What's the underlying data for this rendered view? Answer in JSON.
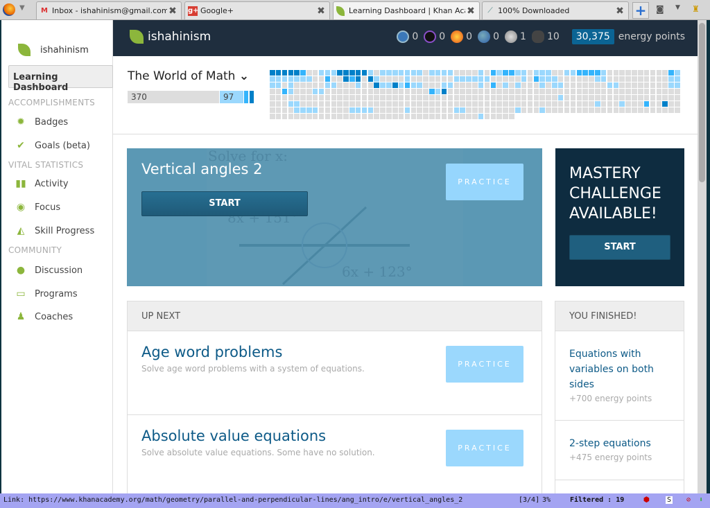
{
  "browser": {
    "tabs": [
      {
        "title": "Inbox - ishahinism@gmail.com ...",
        "icon": "gmail-icon"
      },
      {
        "title": "Google+",
        "icon": "google-plus-icon"
      },
      {
        "title": "Learning Dashboard | Khan Aca...",
        "icon": "khan-leaf-icon",
        "active": true
      },
      {
        "title": "100% Downloaded",
        "icon": "download-icon"
      }
    ],
    "new_tab": "+"
  },
  "header": {
    "site": "ishahinism",
    "badges": [
      {
        "icon": "challenge-patch-icon",
        "count": "0",
        "color": "#3b78b8"
      },
      {
        "icon": "black-hole-icon",
        "count": "0",
        "color": "#111"
      },
      {
        "icon": "sun-icon",
        "count": "0",
        "color": "#f28a1a"
      },
      {
        "icon": "earth-icon",
        "count": "0",
        "color": "#2f6fb8"
      },
      {
        "icon": "moon-icon",
        "count": "1",
        "color": "#aaa"
      },
      {
        "icon": "meteorite-icon",
        "count": "10",
        "color": "#444"
      }
    ],
    "energy_points": "30,375",
    "energy_label": "energy points"
  },
  "sidebar": {
    "user": "ishahinism",
    "active": "Learning Dashboard",
    "sections": [
      {
        "title": "ACCOMPLISHMENTS",
        "items": [
          {
            "label": "Badges",
            "icon": "badge-icon"
          },
          {
            "label": "Goals (beta)",
            "icon": "check-circle-icon"
          }
        ]
      },
      {
        "title": "VITAL STATISTICS",
        "items": [
          {
            "label": "Activity",
            "icon": "bar-chart-icon"
          },
          {
            "label": "Focus",
            "icon": "target-icon"
          },
          {
            "label": "Skill Progress",
            "icon": "trend-icon"
          }
        ]
      },
      {
        "title": "COMMUNITY",
        "items": [
          {
            "label": "Discussion",
            "icon": "chat-icon"
          },
          {
            "label": "Programs",
            "icon": "monitor-icon"
          },
          {
            "label": "Coaches",
            "icon": "person-icon"
          }
        ]
      }
    ]
  },
  "mission": {
    "title": "The World of Math",
    "chevron": "chevron-down-icon",
    "unstarted": "370",
    "practiced": "97",
    "grid_levels": [
      "3333320011133333101111111011110000102122110111001122221000000000021",
      "1111111002003230310000100000001111110000010211100000011000000000011",
      "1101000001100010031131211000110000102010100010110000000110000000011",
      "0021000110000000000000000021300000000000000000000000000000000000000",
      "0000000000000000000000000000000000000000000000010000000000000000000",
      "0001100000000000000000000000000000000000000000000000010001000200300",
      "0000111100000111100000100000001100000000100010000000000000000000000",
      "0000000000000000000000000000000000100000"
    ],
    "level_colors": [
      "#dddddd",
      "#9bd8fd",
      "#34b4fc",
      "#0080c8"
    ]
  },
  "hero": {
    "title": "Vertical angles 2",
    "start": "START",
    "practice": "PRACTICE",
    "bg_text": [
      "Solve for x:",
      "8x + 151°",
      "6x + 123°"
    ]
  },
  "mastery": {
    "title": "MASTERY CHALLENGE AVAILABLE!",
    "start": "START"
  },
  "up_next": {
    "header": "UP NEXT",
    "items": [
      {
        "title": "Age word problems",
        "desc": "Solve age word problems with a system of equations.",
        "practice": "PRACTICE"
      },
      {
        "title": "Absolute value equations",
        "desc": "Solve absolute value equations. Some have no solution.",
        "practice": "PRACTICE"
      }
    ]
  },
  "finished": {
    "header": "YOU FINISHED!",
    "items": [
      {
        "title": "Equations with variables on both sides",
        "points": "+700 energy points"
      },
      {
        "title": "2-step equations",
        "points": "+475 energy points"
      }
    ]
  },
  "status": {
    "link": "Link:  https://www.khanacademy.org/math/geometry/parallel-and-perpendicular-lines/ang_intro/e/vertical_angles_2",
    "tabs": "[3/4]",
    "zoom": "3%",
    "filtered": "Filtered : 19"
  }
}
